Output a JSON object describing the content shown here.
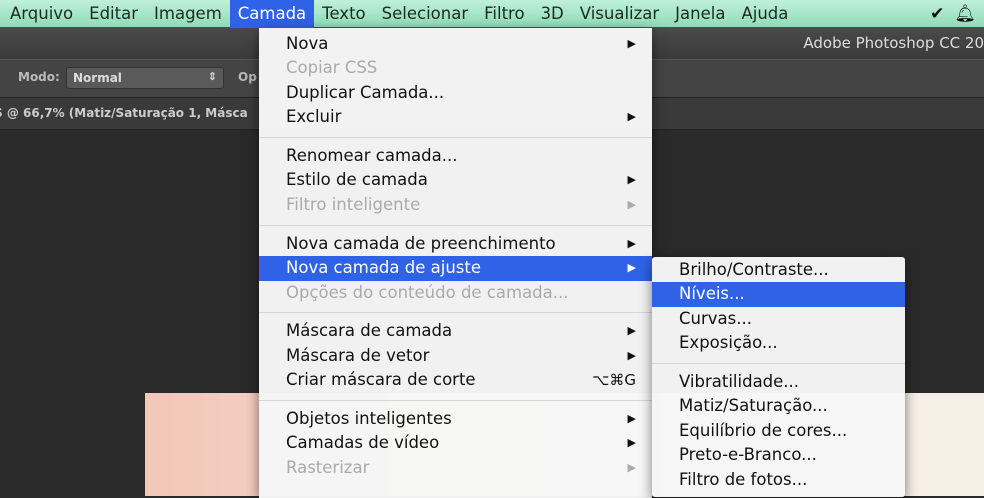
{
  "menubar": {
    "items": [
      "Arquivo",
      "Editar",
      "Imagem",
      "Camada",
      "Texto",
      "Selecionar",
      "Filtro",
      "3D",
      "Visualizar",
      "Janela",
      "Ajuda"
    ],
    "active": "Camada"
  },
  "app_title": "Adobe Photoshop CC 20",
  "options": {
    "mode_label": "Modo:",
    "mode_value": "Normal",
    "opacity_label": "Op"
  },
  "document": {
    "title": "S @ 66,7% (Matiz/Saturação 1, Másca"
  },
  "main_menu": {
    "groups": [
      [
        {
          "label": "Nova",
          "submenu": true
        },
        {
          "label": "Copiar CSS",
          "disabled": true
        },
        {
          "label": "Duplicar Camada..."
        },
        {
          "label": "Excluir",
          "submenu": true
        }
      ],
      [
        {
          "label": "Renomear camada..."
        },
        {
          "label": "Estilo de camada",
          "submenu": true
        },
        {
          "label": "Filtro inteligente",
          "submenu": true,
          "disabled": true
        }
      ],
      [
        {
          "label": "Nova camada de preenchimento",
          "submenu": true
        },
        {
          "label": "Nova camada de ajuste",
          "submenu": true,
          "highlighted": true
        },
        {
          "label": "Opções do conteúdo de camada...",
          "disabled": true
        }
      ],
      [
        {
          "label": "Máscara de camada",
          "submenu": true
        },
        {
          "label": "Máscara de vetor",
          "submenu": true
        },
        {
          "label": "Criar máscara de corte",
          "shortcut": "⌥⌘G"
        }
      ],
      [
        {
          "label": "Objetos inteligentes",
          "submenu": true
        },
        {
          "label": "Camadas de vídeo",
          "submenu": true
        },
        {
          "label": "Rasterizar",
          "submenu": true,
          "disabled": true
        }
      ]
    ]
  },
  "sub_menu": {
    "groups": [
      [
        {
          "label": "Brilho/Contraste..."
        },
        {
          "label": "Níveis...",
          "highlighted": true
        },
        {
          "label": "Curvas..."
        },
        {
          "label": "Exposição..."
        }
      ],
      [
        {
          "label": "Vibratilidade..."
        },
        {
          "label": "Matiz/Saturação..."
        },
        {
          "label": "Equilíbrio de cores..."
        },
        {
          "label": "Preto-e-Branco..."
        },
        {
          "label": "Filtro de fotos..."
        }
      ]
    ]
  },
  "colors": {
    "highlight": "#2f62e6",
    "menubar": "#a8e6c9"
  }
}
